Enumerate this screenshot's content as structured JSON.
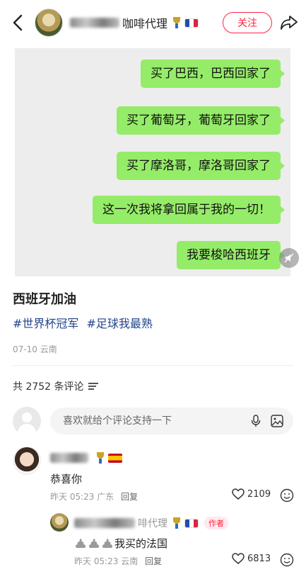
{
  "header": {
    "author_name_visible": "咖啡代理",
    "follow_label": "关注"
  },
  "chat": {
    "messages": [
      "买了巴西，巴西回家了",
      "买了葡萄牙，葡萄牙回家了",
      "买了摩洛哥，摩洛哥回家了",
      "这一次我将拿回属于我的一切！",
      "我要梭哈西班牙"
    ],
    "bubble_color": "#95ec69"
  },
  "post": {
    "title": "西班牙加油",
    "tags": [
      "#世界杯冠军",
      "#足球我最熟"
    ],
    "date": "07-10",
    "location": "云南"
  },
  "comments_section": {
    "count_label": "共 2752 条评论",
    "input_placeholder": "喜欢就给个评论支持一下"
  },
  "comments": [
    {
      "text": "恭喜你",
      "time": "昨天 05:23",
      "location": "广东",
      "reply_label": "回复",
      "likes": "2109"
    }
  ],
  "reply": {
    "author_visible": "啡代理",
    "author_badge": "作者",
    "text": "我买的法国",
    "time": "昨天 05:23",
    "location": "云南",
    "reply_label": "回复",
    "likes": "6813"
  },
  "colors": {
    "accent": "#ff2442",
    "tag": "#23458a"
  }
}
